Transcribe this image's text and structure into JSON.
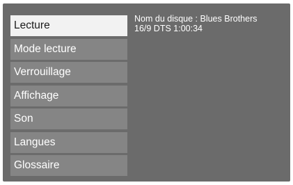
{
  "menu": {
    "selected_index": 0,
    "items": [
      {
        "label": "Lecture"
      },
      {
        "label": "Mode lecture"
      },
      {
        "label": "Verrouillage"
      },
      {
        "label": "Affichage"
      },
      {
        "label": "Son"
      },
      {
        "label": "Langues"
      },
      {
        "label": "Glossaire"
      }
    ]
  },
  "info": {
    "line1": "Nom du disque : Blues Brothers",
    "line2": "16/9 DTS 1:00:34"
  },
  "colors": {
    "screen_background": "#6b6b6b",
    "menu_item_background": "#858585",
    "menu_item_selected_background": "#f2f2f2",
    "menu_item_text": "#ffffff",
    "menu_item_selected_text": "#1a1a1a"
  }
}
